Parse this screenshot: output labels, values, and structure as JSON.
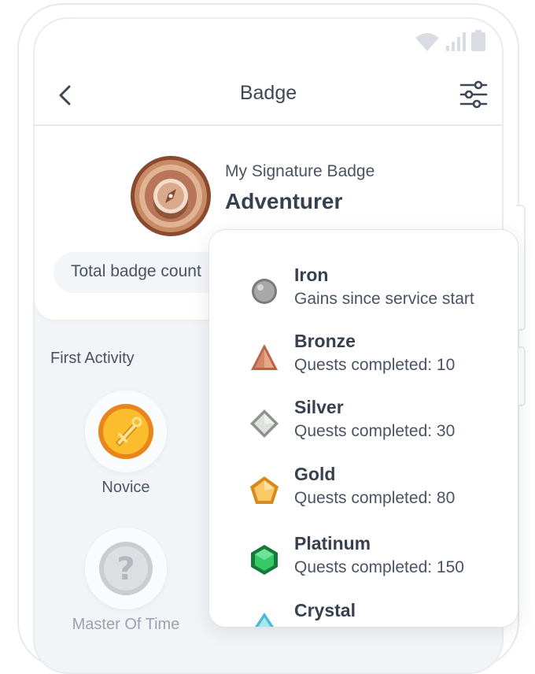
{
  "header": {
    "title": "Badge"
  },
  "icons": {
    "back": "chevron-left-icon",
    "filter": "sliders-icon",
    "wifi": "wifi-icon",
    "signal": "signal-icon",
    "battery": "battery-icon"
  },
  "profile": {
    "signature_label": "My Signature Badge",
    "signature_name": "Adventurer",
    "total_label": "Total badge count"
  },
  "section": {
    "title": "First Activity"
  },
  "badges": [
    {
      "label": "Novice",
      "icon": "sword-coin-icon",
      "locked": false
    },
    {
      "label": "Master Of Time",
      "icon": "question-coin-icon",
      "locked": true
    }
  ],
  "tiers": [
    {
      "name": "Iron",
      "desc": "Gains since service start",
      "icon": "iron-circle-icon",
      "color": "#9a9a9a"
    },
    {
      "name": "Bronze",
      "desc": "Quests completed: 10",
      "icon": "bronze-triangle-icon",
      "color": "#d4896a"
    },
    {
      "name": "Silver",
      "desc": "Quests completed: 30",
      "icon": "silver-diamond-icon",
      "color": "#c9cfc9"
    },
    {
      "name": "Gold",
      "desc": "Quests completed: 80",
      "icon": "gold-pentagon-icon",
      "color": "#f6b54a"
    },
    {
      "name": "Platinum",
      "desc": "Quests completed: 150",
      "icon": "platinum-hexagon-icon",
      "color": "#2dbb5c"
    },
    {
      "name": "Crystal",
      "desc": "",
      "icon": "crystal-drop-icon",
      "color": "#7fd6ea"
    }
  ]
}
